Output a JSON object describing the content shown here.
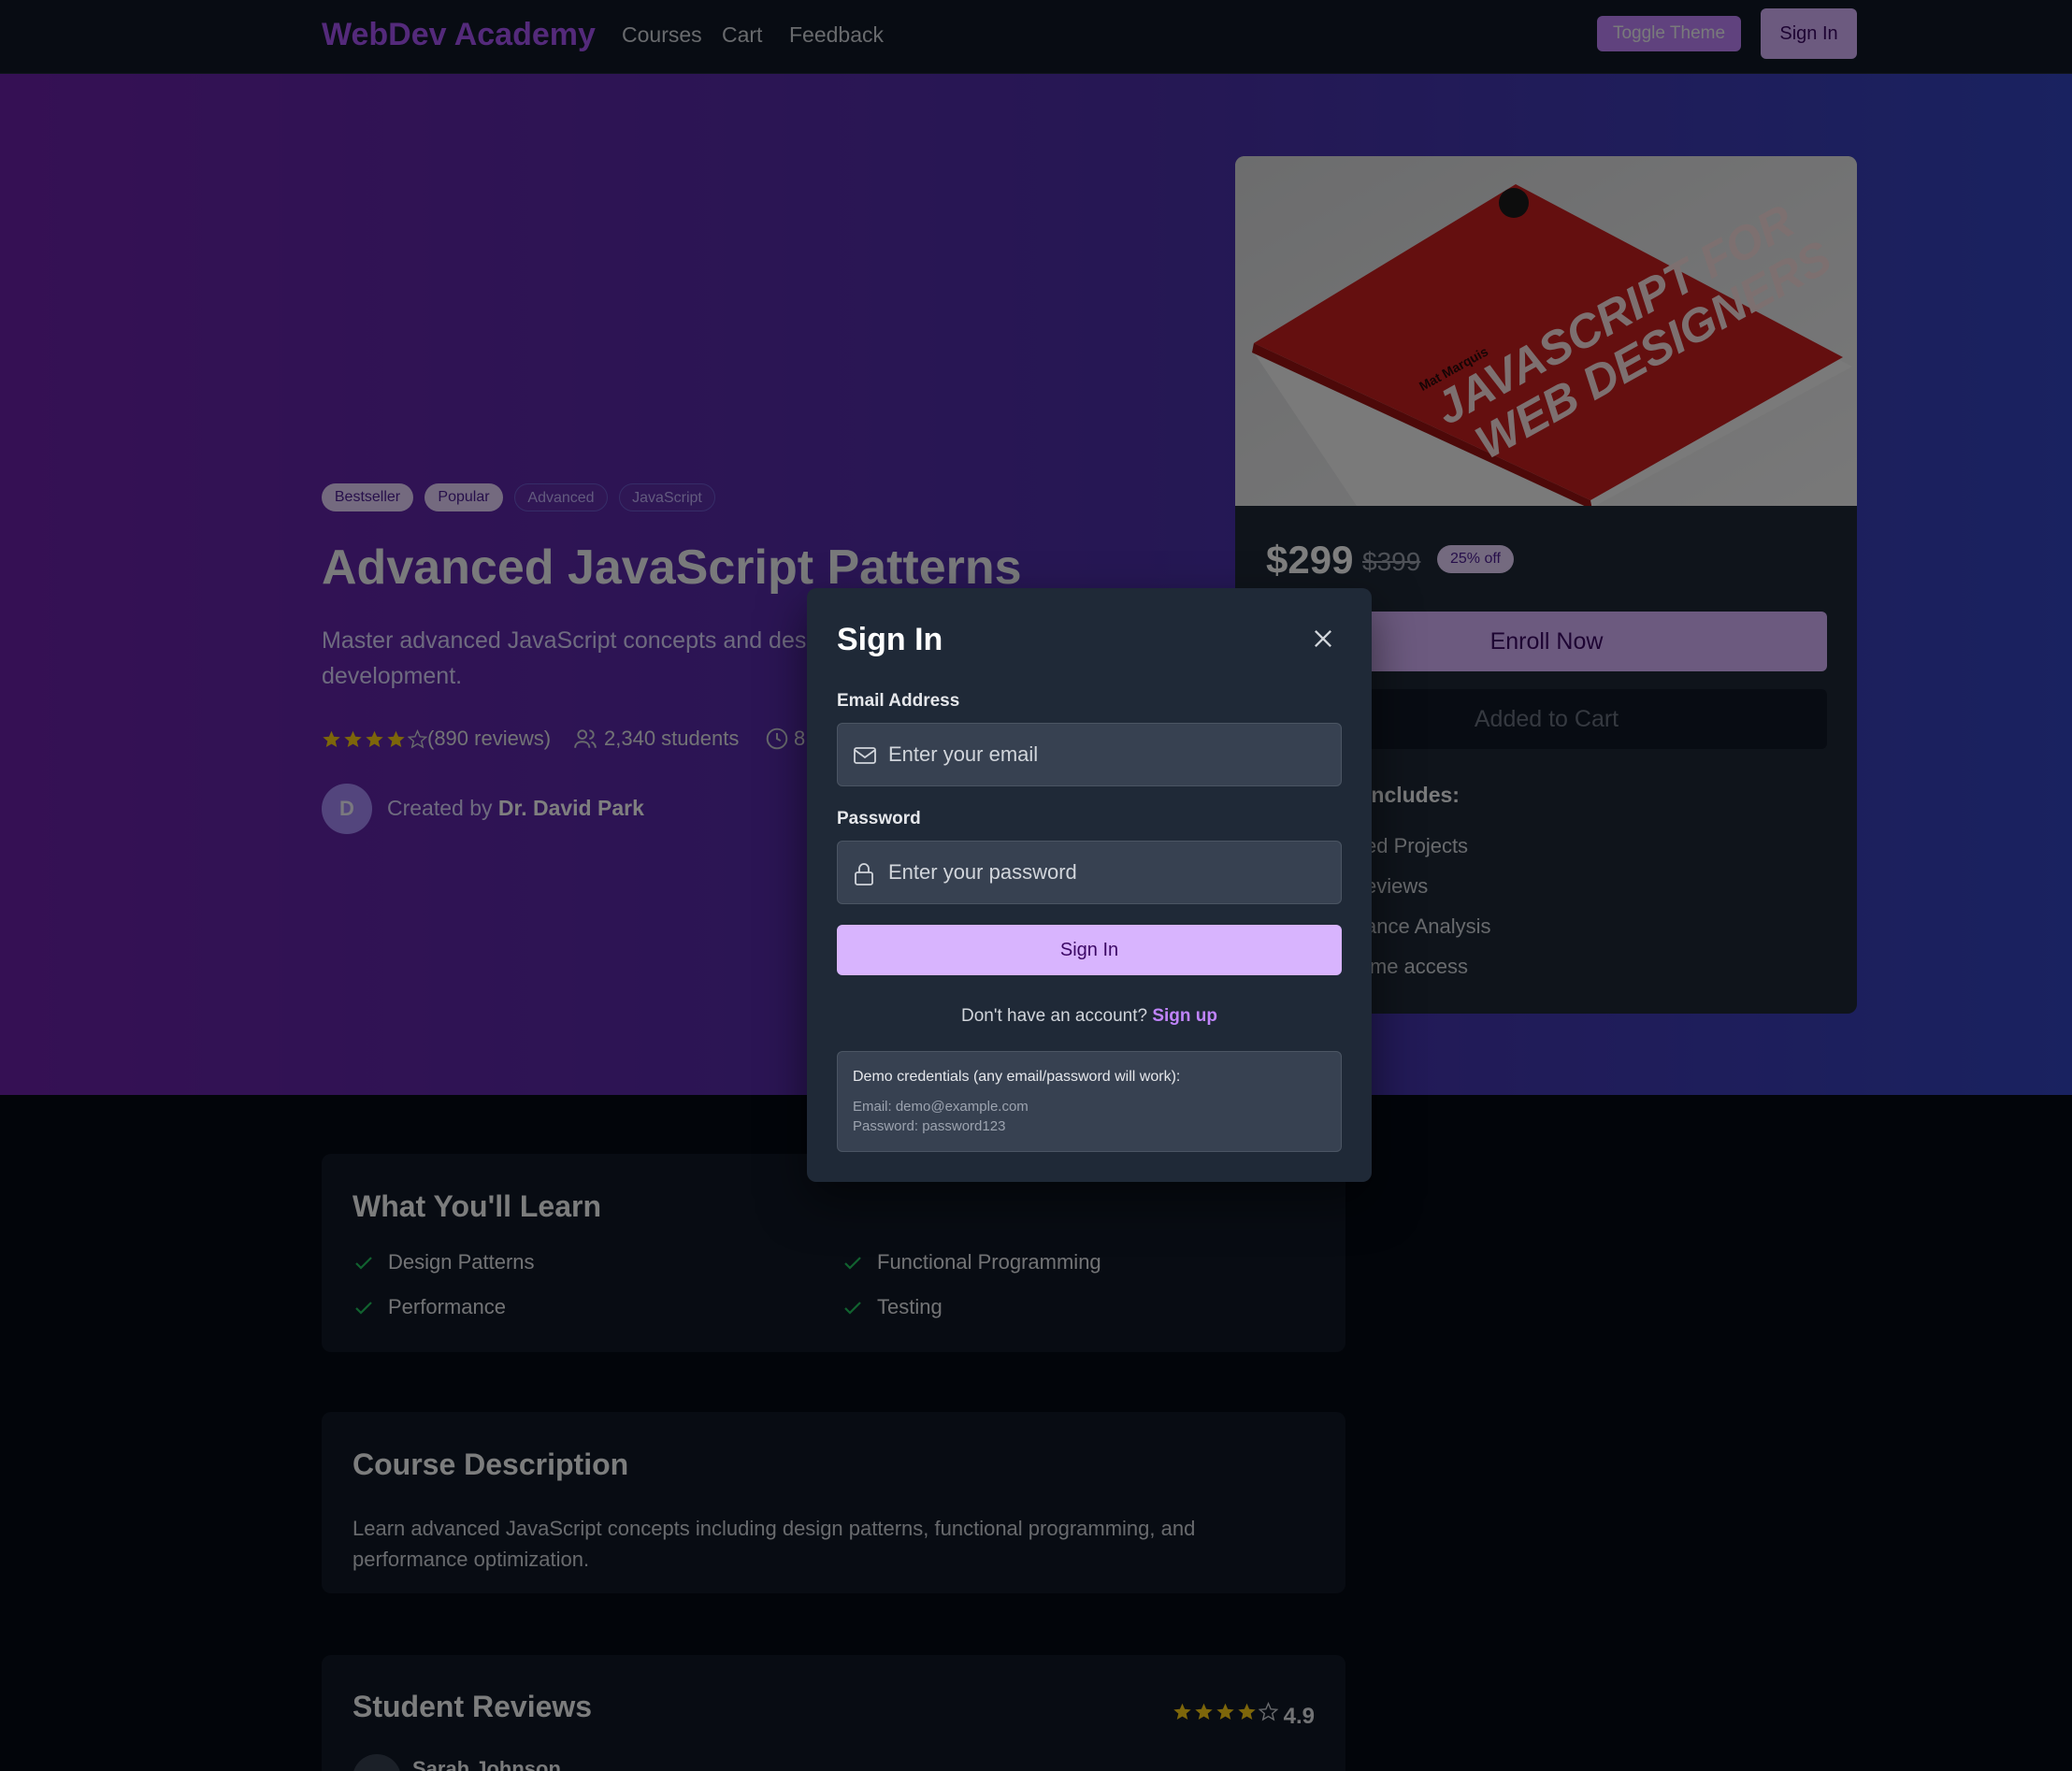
{
  "header": {
    "logo": "WebDev Academy",
    "nav": [
      "Courses",
      "Cart",
      "Feedback"
    ],
    "toggle_theme": "Toggle Theme",
    "sign_in": "Sign In"
  },
  "course": {
    "badges": [
      "Bestseller",
      "Popular",
      "Advanced",
      "JavaScript"
    ],
    "title": "Advanced JavaScript Patterns",
    "subtitle": "Master advanced JavaScript concepts and design patterns for professional development.",
    "rating": 4,
    "reviews": "(890 reviews)",
    "students": "2,340 students",
    "duration_visible": "8",
    "creator_initial": "D",
    "creator_prefix": "Created by",
    "creator_name": "Dr. David Park"
  },
  "pricing": {
    "price": "$299",
    "old_price": "$399",
    "discount": "25% off",
    "enroll": "Enroll Now",
    "added_to_cart": "Added to Cart",
    "includes_title": "includes:",
    "includes": [
      "ed Projects",
      "eviews",
      "ance Analysis",
      "ime access"
    ]
  },
  "learn": {
    "title": "What You'll Learn",
    "items": [
      "Design Patterns",
      "Functional Programming",
      "Performance",
      "Testing"
    ]
  },
  "description": {
    "title": "Course Description",
    "text": "Learn advanced JavaScript concepts including design patterns, functional programming, and performance optimization."
  },
  "reviews": {
    "title": "Student Reviews",
    "rating": "4.9",
    "first_reviewer": "Sarah Johnson"
  },
  "modal": {
    "title": "Sign In",
    "email_label": "Email Address",
    "email_placeholder": "Enter your email",
    "password_label": "Password",
    "password_placeholder": "Enter your password",
    "submit": "Sign In",
    "no_account": "Don't have an account?",
    "sign_up": "Sign up",
    "demo_heading": "Demo credentials (any email/password will work):",
    "demo_email": "Email: demo@example.com",
    "demo_password": "Password: password123"
  },
  "colors": {
    "accent": "#d8b4fe",
    "star": "#facc15",
    "check": "#22c55e"
  }
}
